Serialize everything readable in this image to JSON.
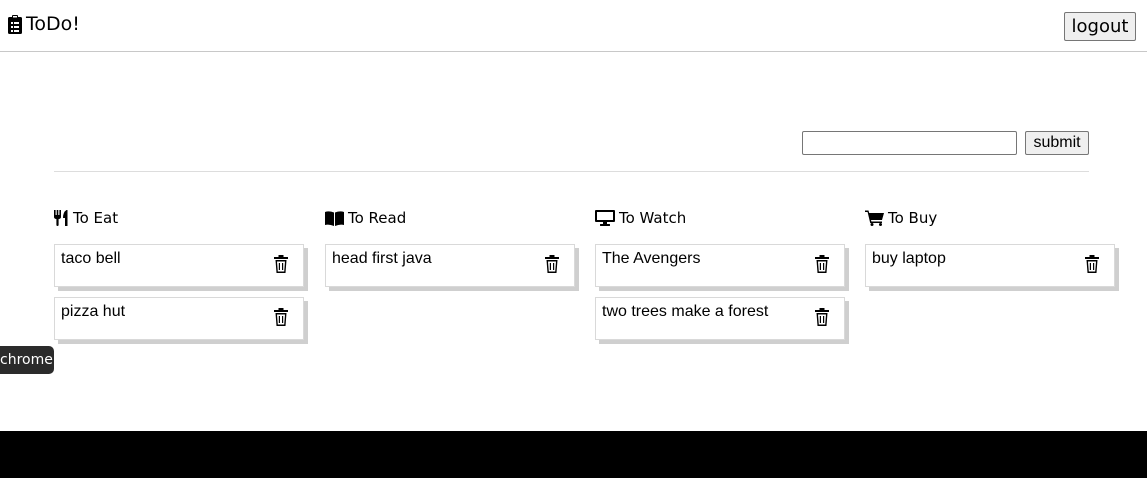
{
  "navbar": {
    "brand": "ToDo!",
    "brand_icon": "clipboard-icon",
    "logout_label": "logout"
  },
  "form": {
    "input_value": "",
    "submit_label": "submit"
  },
  "columns": [
    {
      "title": "To Eat",
      "icon": "utensils-icon",
      "items": [
        "taco bell",
        "pizza hut"
      ]
    },
    {
      "title": "To Read",
      "icon": "book-icon",
      "items": [
        "head first java"
      ]
    },
    {
      "title": "To Watch",
      "icon": "tv-icon",
      "items": [
        "The Avengers",
        "two trees make a forest"
      ]
    },
    {
      "title": "To Buy",
      "icon": "cart-icon",
      "items": [
        "buy laptop"
      ]
    }
  ],
  "item_icon": "trash-icon",
  "tooltip": "chrome",
  "colors": {
    "text": "#000000",
    "card_shadow": "#cfcfcf",
    "tooltip_bg": "#2b2b2b",
    "bottom_bar": "#000000"
  }
}
